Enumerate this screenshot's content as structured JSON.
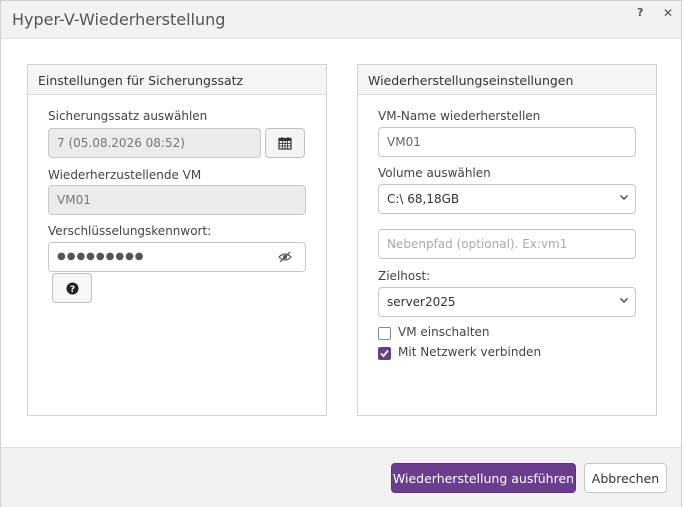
{
  "dialog": {
    "title": "Hyper-V-Wiederherstellung",
    "help_label": "?",
    "close_label": "✕"
  },
  "left_panel": {
    "heading": "Einstellungen für Sicherungssatz",
    "backup_set_label": "Sicherungssatz auswählen",
    "backup_set_value": "7 (05.08.2026 08:52)",
    "vm_label": "Wiederherzustellende VM",
    "vm_value": "VM01",
    "password_label": "Verschlüsselungskennwort:",
    "password_value": "●●●●●●●●●"
  },
  "right_panel": {
    "heading": "Wiederherstellungseinstellungen",
    "vm_name_label": "VM-Name wiederherstellen",
    "vm_name_value": "VM01",
    "volume_label": "Volume auswählen",
    "volume_value": "C:\\ 68,18GB",
    "subpath_placeholder": "Nebenpfad (optional). Ex:vm1",
    "host_label": "Zielhost:",
    "host_value": "server2025",
    "power_on_label": "VM einschalten",
    "power_on_checked": false,
    "network_label": "Mit Netzwerk verbinden",
    "network_checked": true
  },
  "footer": {
    "run_label": "Wiederherstellung ausführen",
    "cancel_label": "Abbrechen"
  },
  "colors": {
    "accent": "#6b3d8f"
  }
}
